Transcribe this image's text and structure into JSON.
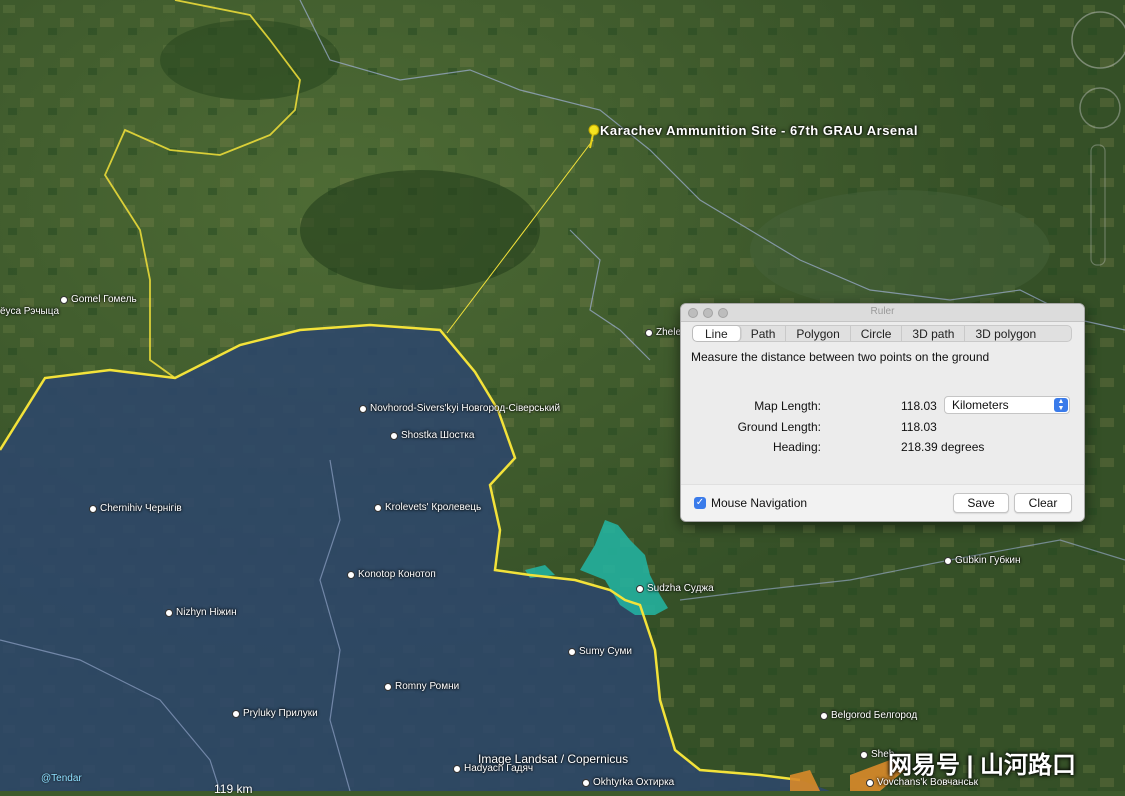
{
  "map": {
    "pin_label": "Karachev Ammunition Site - 67th GRAU Arsenal",
    "places": [
      {
        "label": "Gomel Гомель",
        "dot": true
      },
      {
        "label": "ёуса Рэчыца",
        "dot": false
      },
      {
        "label": "Novhorod-Sivers'kyi Новгород-Сіверський",
        "dot": true
      },
      {
        "label": "Shostka Шостка",
        "dot": true
      },
      {
        "label": "Chernihiv Чернігів",
        "dot": true
      },
      {
        "label": "Krolevets' Кролевець",
        "dot": true
      },
      {
        "label": "Konotop Конотоп",
        "dot": true
      },
      {
        "label": "Nizhyn Ніжин",
        "dot": true
      },
      {
        "label": "Sudzha Суджа",
        "dot": true
      },
      {
        "label": "Sumy Суми",
        "dot": true
      },
      {
        "label": "Romny Ромни",
        "dot": true
      },
      {
        "label": "Pryluky Прилуки",
        "dot": true
      },
      {
        "label": "Hadyach Гадяч",
        "dot": true
      },
      {
        "label": "Okhtyrka Охтирка",
        "dot": true
      },
      {
        "label": "Belgorod Белгород",
        "dot": true
      },
      {
        "label": "Gubkin Губкин",
        "dot": true
      },
      {
        "label": "Zhele",
        "dot": true
      },
      {
        "label": "Sheb",
        "dot": true
      },
      {
        "label": "Vovchans'k Вовчанськ",
        "dot": true
      }
    ],
    "credit": "Image Landsat / Copernicus",
    "tendar": "@Tendar",
    "scale_text": "119 km",
    "watermark": "网易号 | 山河路口"
  },
  "ruler": {
    "title": "Ruler",
    "tabs": [
      "Line",
      "Path",
      "Polygon",
      "Circle",
      "3D path",
      "3D polygon"
    ],
    "active_tab": "Line",
    "description": "Measure the distance between two points on the ground",
    "map_length_label": "Map Length:",
    "map_length_value": "118.03",
    "ground_length_label": "Ground Length:",
    "ground_length_value": "118.03",
    "heading_label": "Heading:",
    "heading_value": "218.39 degrees",
    "unit_selected": "Kilometers",
    "mouse_nav_label": "Mouse Navigation",
    "mouse_nav_checked": true,
    "save_label": "Save",
    "clear_label": "Clear"
  },
  "colors": {
    "border_yellow": "#f3e23a",
    "ukraine_tint": "#2f4a73",
    "sudzha_fill": "#22b6a4",
    "accent_blue": "#3a7bea"
  }
}
